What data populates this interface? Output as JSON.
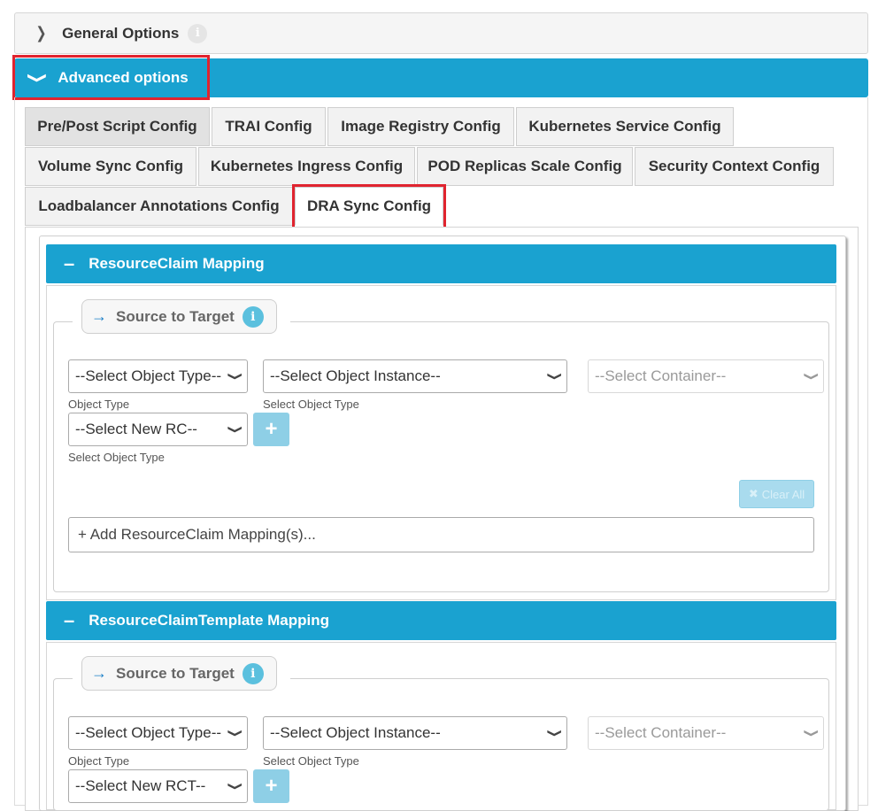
{
  "panels": {
    "general": {
      "title": "General Options",
      "chevron_icon": "chevron-right-icon",
      "info_icon": "info-icon"
    },
    "advanced": {
      "title": "Advanced options",
      "chevron_icon": "chevron-down-icon"
    }
  },
  "tabs": [
    "Pre/Post Script Config",
    "TRAI Config",
    "Image Registry Config",
    "Kubernetes Service Config",
    "Volume Sync Config",
    "Kubernetes Ingress Config",
    "POD Replicas Scale Config",
    "Security Context Config",
    "Loadbalancer Annotations Config",
    "DRA Sync Config"
  ],
  "selected_tab": "DRA Sync Config",
  "sections": [
    {
      "title": "ResourceClaim Mapping",
      "legend": "Source to Target",
      "object_type": "--Select Object Type--",
      "object_type_hint": "Object Type",
      "object_instance": "--Select Object Instance--",
      "object_instance_hint": "Select Object Type",
      "container": "--Select Container--",
      "new_select": "--Select New RC--",
      "new_select_hint": "Select Object Type",
      "clear_all": "Clear All",
      "add_placeholder": "+ Add ResourceClaim Mapping(s)..."
    },
    {
      "title": "ResourceClaimTemplate Mapping",
      "legend": "Source to Target",
      "object_type": "--Select Object Type--",
      "object_type_hint": "Object Type",
      "object_instance": "--Select Object Instance--",
      "object_instance_hint": "Select Object Type",
      "container": "--Select Container--",
      "new_select": "--Select New RCT--"
    }
  ],
  "colors": {
    "accent": "#1aa2d0",
    "highlight": "#e0242f",
    "info": "#5bc0de"
  }
}
